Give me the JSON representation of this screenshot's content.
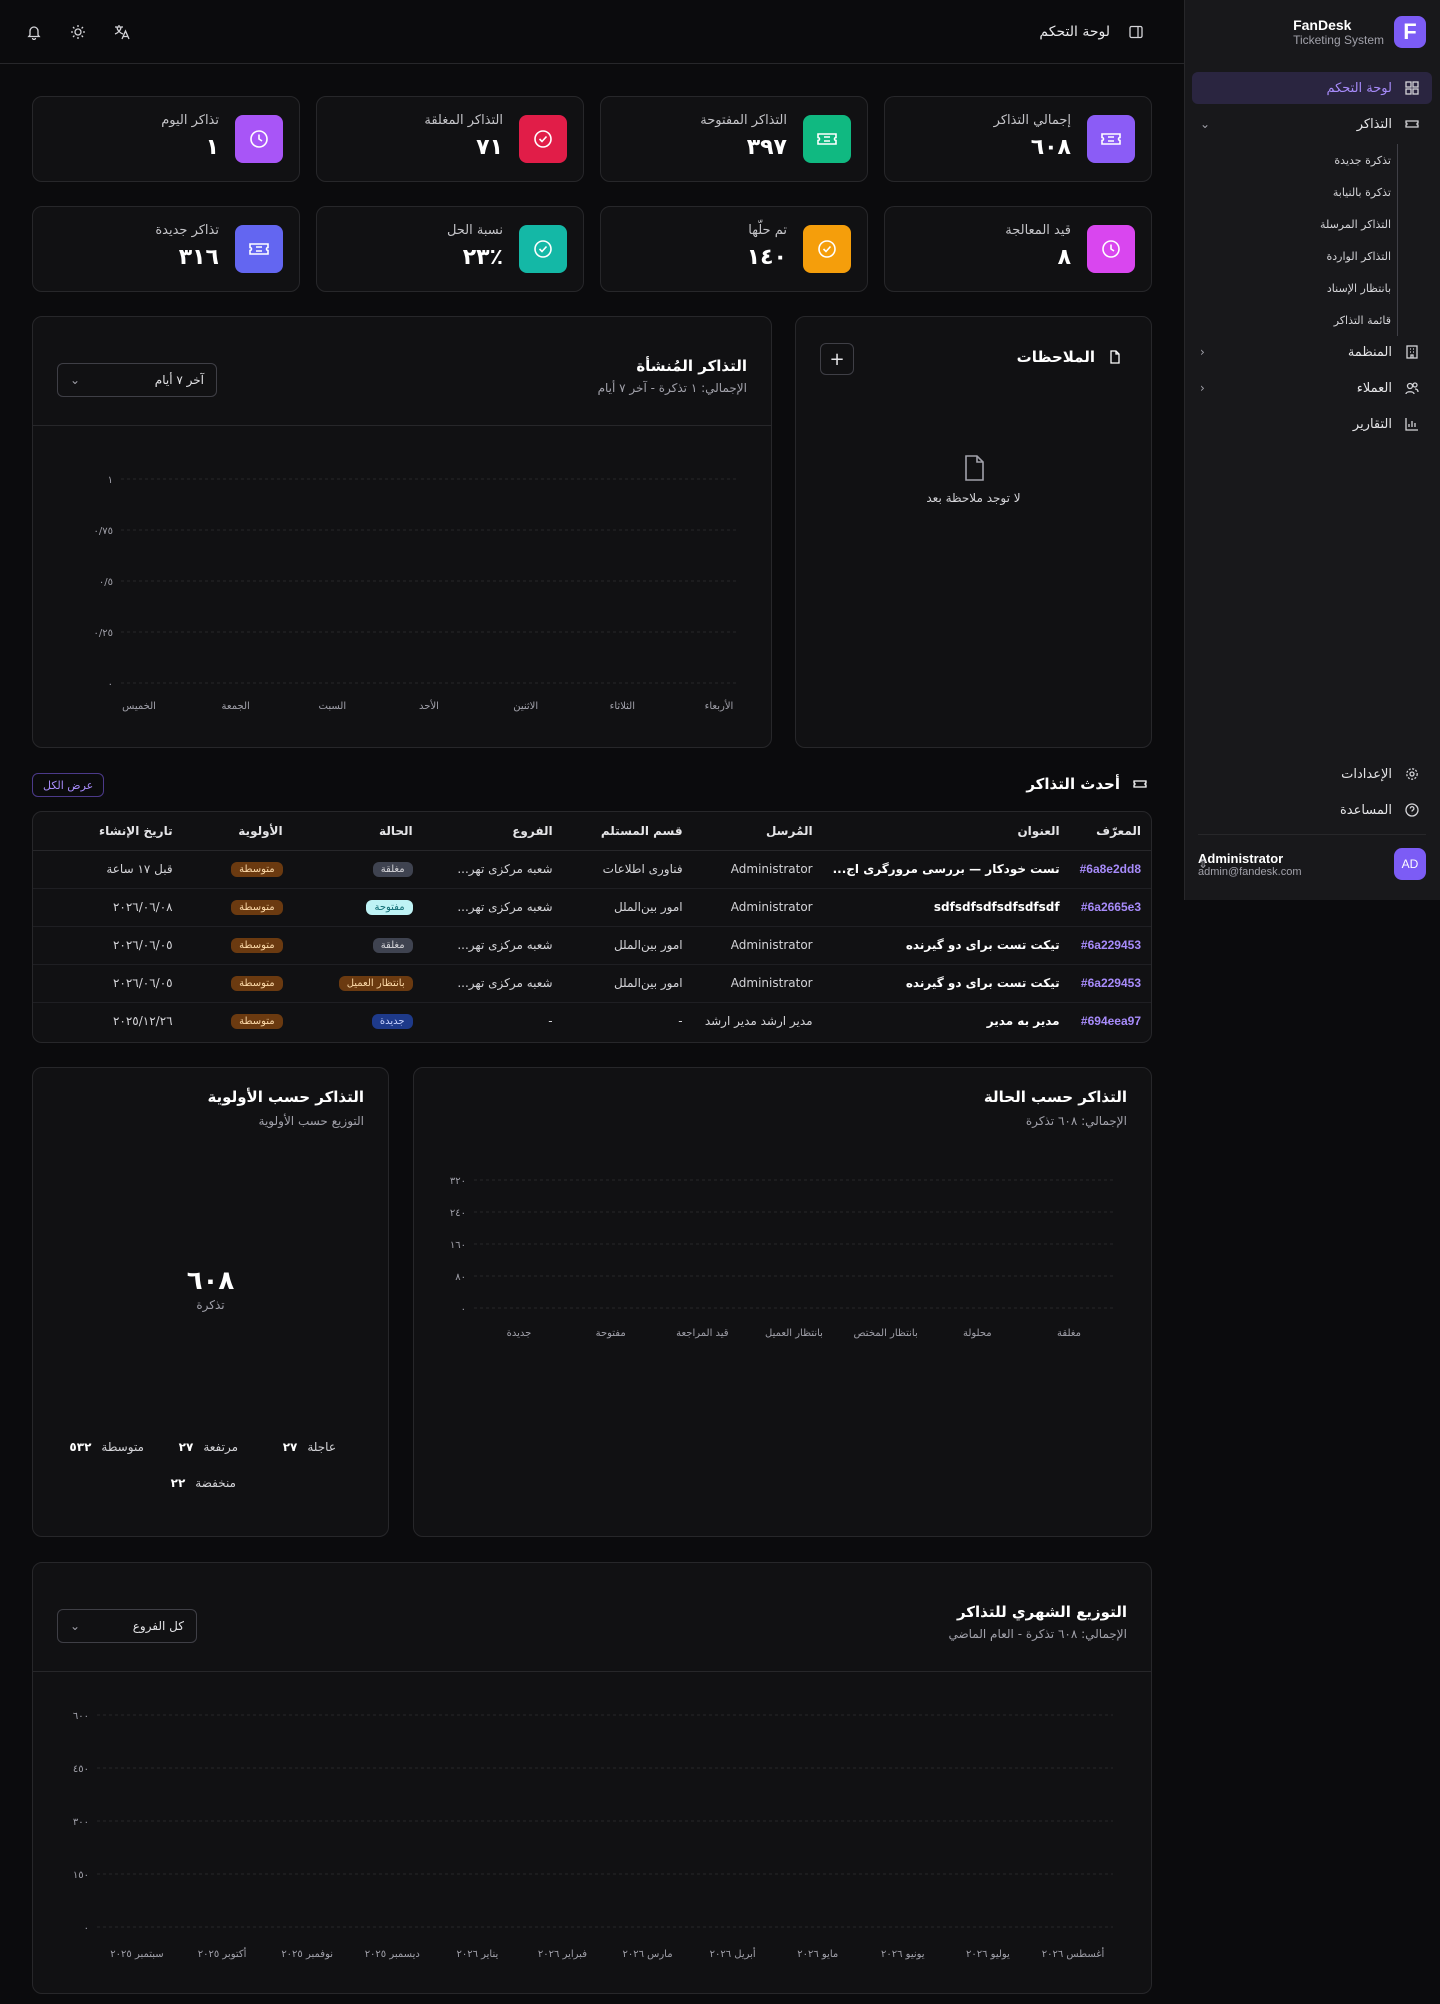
{
  "sidebar": {
    "brand_name": "FanDesk",
    "brand_sub": "Ticketing System",
    "logo_letter": "F",
    "items": [
      {
        "label": "لوحة التحكم",
        "icon": "dashboard-icon"
      },
      {
        "label": "التذاكر",
        "icon": "ticket-icon"
      },
      {
        "label": "المنظمة",
        "icon": "building-icon"
      },
      {
        "label": "العملاء",
        "icon": "users-icon"
      },
      {
        "label": "التقارير",
        "icon": "chart-icon"
      }
    ],
    "ticket_sub": [
      "تذكرة جديدة",
      "تذكرة بالنيابة",
      "التذاكر المرسلة",
      "التذاكر الواردة",
      "بانتظار الإسناد",
      "قائمة التذاكر"
    ],
    "bottom": [
      {
        "label": "الإعدادات",
        "icon": "gear-icon"
      },
      {
        "label": "المساعدة",
        "icon": "help-icon"
      }
    ],
    "user": {
      "name": "Administrator",
      "email": "admin@fandesk.com",
      "initials": "AD"
    }
  },
  "topbar": {
    "title": "لوحة التحكم"
  },
  "stats": [
    {
      "label": "إجمالي التذاكر",
      "value": "٦٠٨",
      "color": "#8b5cf6",
      "icon": "ticket-icon"
    },
    {
      "label": "التذاكر المفتوحة",
      "value": "٣٩٧",
      "color": "#10b981",
      "icon": "ticket-icon"
    },
    {
      "label": "التذاكر المغلقة",
      "value": "٧١",
      "color": "#e11d48",
      "icon": "check-circle-icon"
    },
    {
      "label": "تذاكر اليوم",
      "value": "١",
      "color": "#a855f7",
      "icon": "clock-icon"
    },
    {
      "label": "قيد المعالجة",
      "value": "٨",
      "color": "#d946ef",
      "icon": "clock-icon"
    },
    {
      "label": "تم حلّها",
      "value": "١٤٠",
      "color": "#f59e0b",
      "icon": "check-circle-icon"
    },
    {
      "label": "نسبة الحل",
      "value": "٪٢٣",
      "color": "#14b8a6",
      "icon": "check-circle-icon"
    },
    {
      "label": "تذاكر جديدة",
      "value": "٣١٦",
      "color": "#6366f1",
      "icon": "ticket-icon"
    }
  ],
  "notes": {
    "title": "الملاحظات",
    "empty": "لا توجد ملاحظة بعد",
    "add": "+"
  },
  "created_chart": {
    "title": "التذاكر المُنشأة",
    "subtitle": "الإجمالي: ١ تذكرة - آخر ٧ أيام",
    "range": "آخر ٧ أيام"
  },
  "latest": {
    "title": "أحدث التذاكر",
    "view_all": "عرض الكل",
    "columns": [
      "المعرّف",
      "العنوان",
      "المُرسل",
      "قسم المستلم",
      "الفروع",
      "الحالة",
      "الأولوية",
      "تاريخ الإنشاء"
    ],
    "rows": [
      {
        "id": "#6a8e2dd8",
        "title": "تست خودکار — بررسی مرورگری اج...",
        "sender": "Administrator",
        "dept": "فناوری اطلاعات",
        "branch": "شعبه مرکزی تهر...",
        "status": "مغلقة",
        "status_kind": "closed",
        "priority": "متوسطة",
        "date": "قبل ١٧ ساعة"
      },
      {
        "id": "#6a2665e3",
        "title": "sdfsdfsdfsdfsdfsdf",
        "sender": "Administrator",
        "dept": "امور بین‌الملل",
        "branch": "شعبه مرکزی تهر...",
        "status": "مفتوحة",
        "status_kind": "open",
        "priority": "متوسطة",
        "date": "٢٠٢٦/٠٦/٠٨"
      },
      {
        "id": "#6a229453",
        "title": "تیکت تست برای دو گیرنده",
        "sender": "Administrator",
        "dept": "امور بین‌الملل",
        "branch": "شعبه مرکزی تهر...",
        "status": "مغلقة",
        "status_kind": "closed",
        "priority": "متوسطة",
        "date": "٢٠٢٦/٠٦/٠٥"
      },
      {
        "id": "#6a229453",
        "title": "تیکت تست برای دو گیرنده",
        "sender": "Administrator",
        "dept": "امور بین‌الملل",
        "branch": "شعبه مرکزی تهر...",
        "status": "بانتظار العميل",
        "status_kind": "wait",
        "priority": "متوسطة",
        "date": "٢٠٢٦/٠٦/٠٥"
      },
      {
        "id": "#694eea97",
        "title": "مدیر به مدیر",
        "sender": "مدیر ارشد مدیر ارشد",
        "dept": "-",
        "branch": "-",
        "status": "جديدة",
        "status_kind": "new",
        "priority": "متوسطة",
        "date": "٢٠٢٥/١٢/٢٦"
      }
    ]
  },
  "status_chart": {
    "title": "التذاكر حسب الحالة",
    "subtitle": "الإجمالي: ٦٠٨ تذكرة"
  },
  "priority_card": {
    "title": "التذاكر حسب الأولوية",
    "subtitle": "التوزيع حسب الأولوية",
    "total": "٦٠٨",
    "unit": "تذكرة",
    "legend": [
      {
        "label": "عاجلة",
        "value": "٢٧"
      },
      {
        "label": "مرتفعة",
        "value": "٢٧"
      },
      {
        "label": "متوسطة",
        "value": "٥٣٢"
      },
      {
        "label": "منخفضة",
        "value": "٢٢"
      }
    ]
  },
  "monthly_chart": {
    "title": "التوزيع الشهري للتذاكر",
    "subtitle": "الإجمالي: ٦٠٨ تذكرة - العام الماضي",
    "branch": "كل الفروع"
  },
  "chart_data": [
    {
      "type": "line",
      "title": "التذاكر المُنشأة",
      "categories": [
        "الأربعاء",
        "الثلاثاء",
        "الاثنين",
        "الأحد",
        "السبت",
        "الجمعة",
        "الخميس"
      ],
      "y_ticks": [
        "١",
        "٠/٧٥",
        "٠/٥",
        "٠/٢٥",
        "٠"
      ],
      "ylim": [
        0,
        1
      ]
    },
    {
      "type": "bar",
      "title": "التذاكر حسب الحالة",
      "categories": [
        "مغلقة",
        "محلولة",
        "بانتظار المختص",
        "بانتظار العميل",
        "قيد المراجعة",
        "مفتوحة",
        "جديدة"
      ],
      "y_ticks": [
        "٣٢٠",
        "٢٤٠",
        "١٦٠",
        "٨٠",
        "٠"
      ],
      "ylim": [
        0,
        320
      ]
    },
    {
      "type": "bar",
      "title": "التوزيع الشهري للتذاكر",
      "categories": [
        "أغسطس ٢٠٢٦",
        "يوليو ٢٠٢٦",
        "يونيو ٢٠٢٦",
        "مايو ٢٠٢٦",
        "أبريل ٢٠٢٦",
        "مارس ٢٠٢٦",
        "فبراير ٢٠٢٦",
        "يناير ٢٠٢٦",
        "ديسمبر ٢٠٢٥",
        "نوفمبر ٢٠٢٥",
        "أكتوبر ٢٠٢٥",
        "سبتمبر ٢٠٢٥"
      ],
      "y_ticks": [
        "٦٠٠",
        "٤٥٠",
        "٣٠٠",
        "١٥٠",
        "٠"
      ],
      "ylim": [
        0,
        600
      ]
    }
  ]
}
